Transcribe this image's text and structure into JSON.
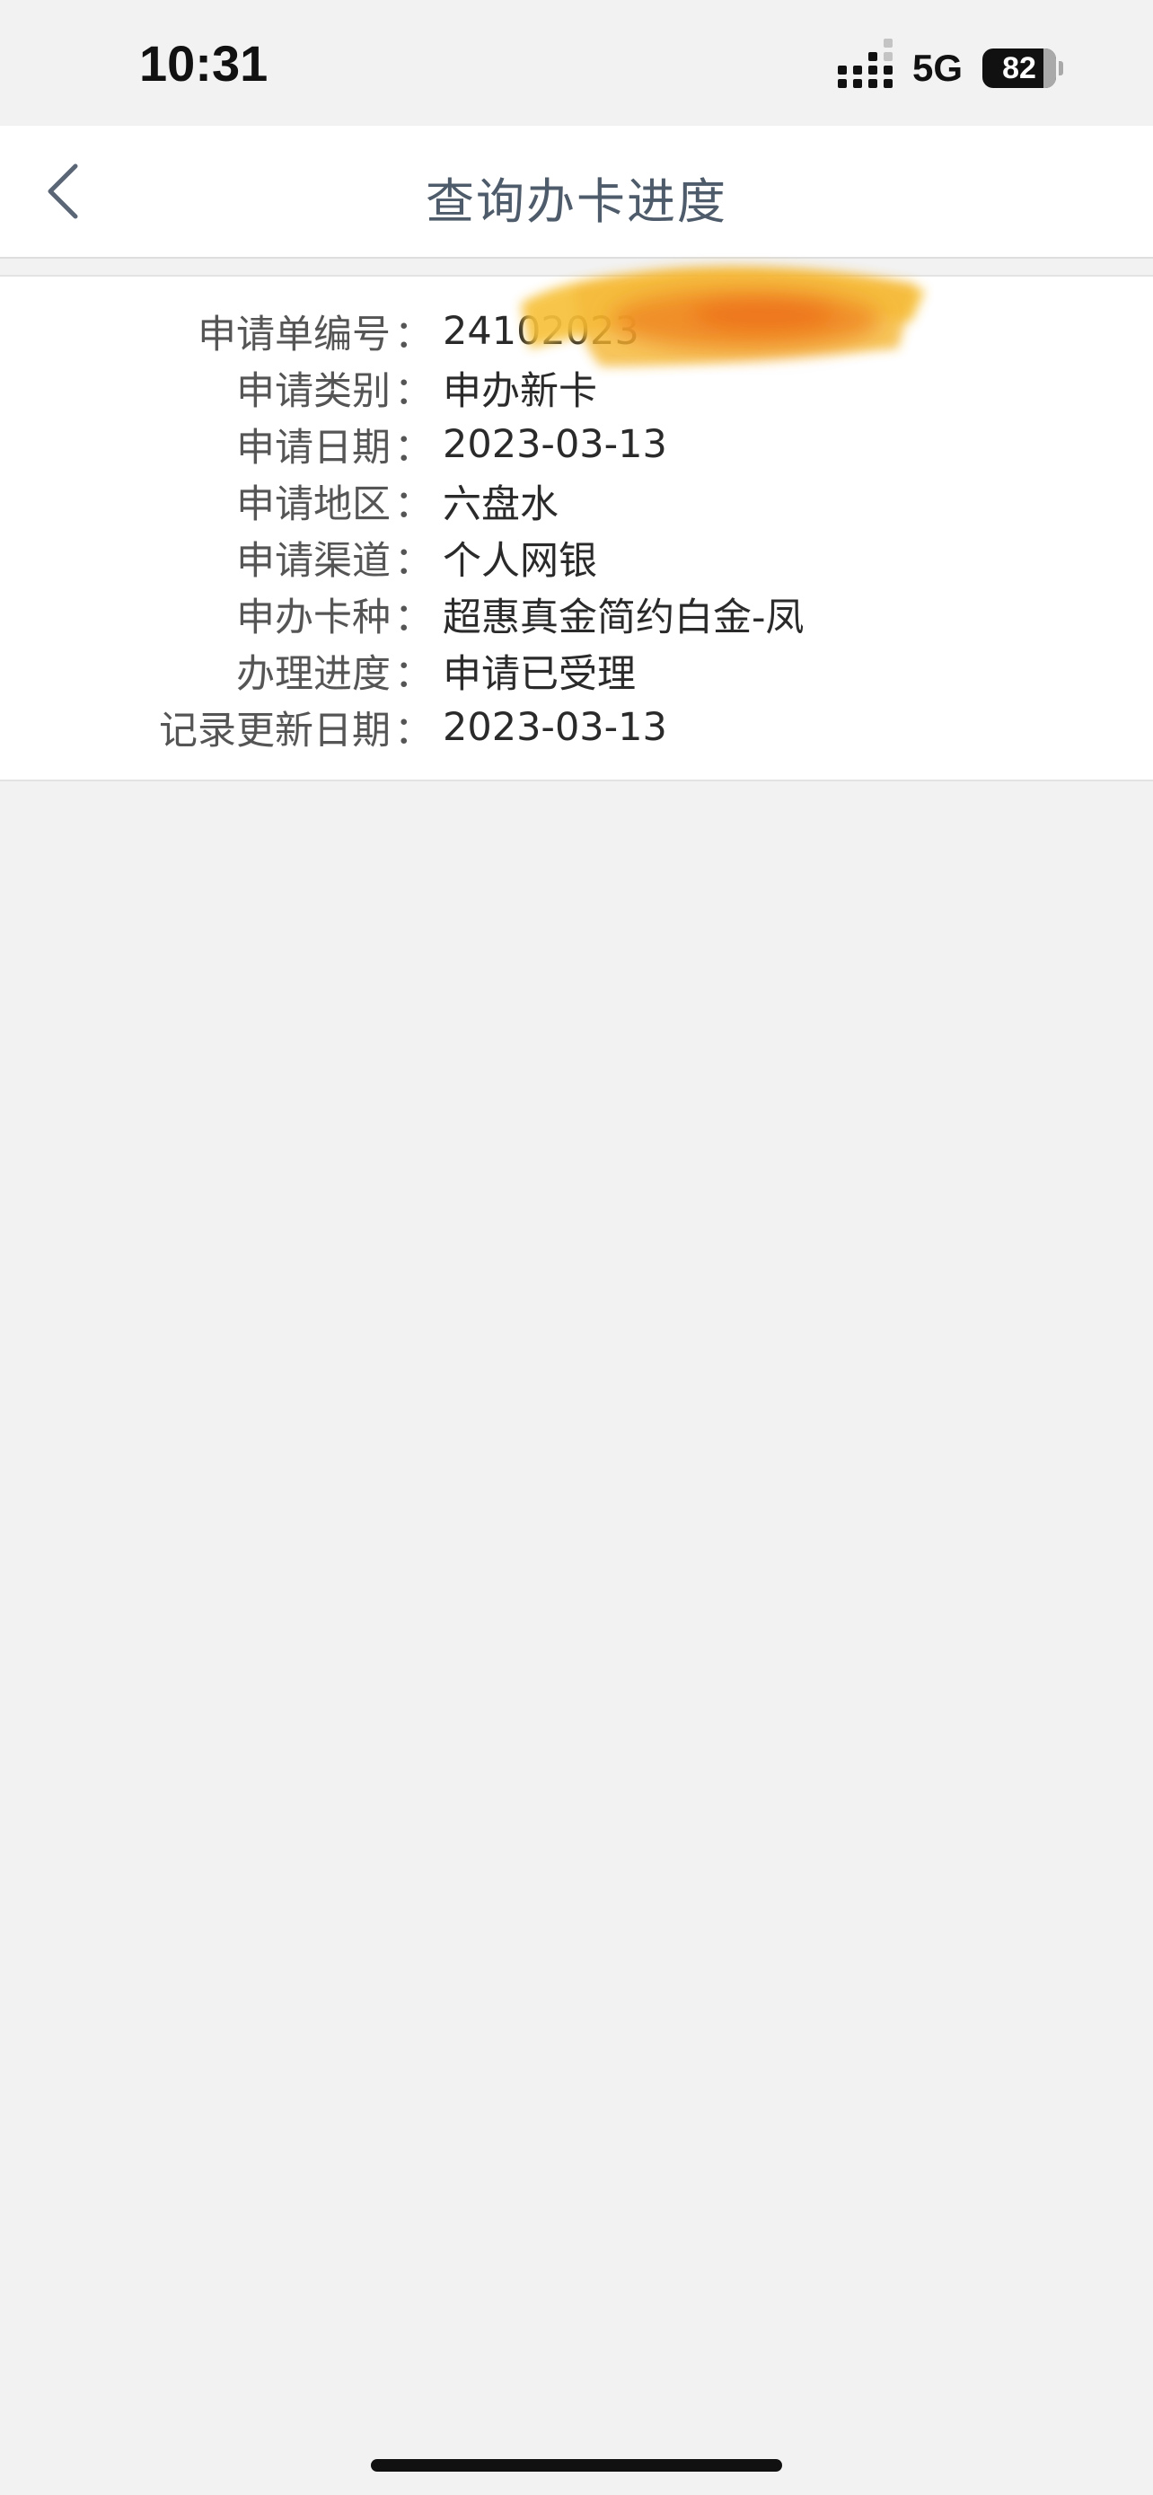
{
  "status_bar": {
    "time": "10:31",
    "network": "5G",
    "battery": "82",
    "icons": [
      "signal-icon",
      "battery-icon"
    ]
  },
  "nav": {
    "title": "查询办卡进度",
    "back_icon": "chevron-left-icon"
  },
  "details": {
    "colon": "：",
    "rows": [
      {
        "label": "申请单编号",
        "value": "24102023"
      },
      {
        "label": "申请类别",
        "value": "申办新卡"
      },
      {
        "label": "申请日期",
        "value": "2023-03-13"
      },
      {
        "label": "申请地区",
        "value": "六盘水"
      },
      {
        "label": "申请渠道",
        "value": "个人网银"
      },
      {
        "label": "申办卡种",
        "value": "超惠真金简约白金-凤"
      },
      {
        "label": "办理进度",
        "value": "申请已受理"
      },
      {
        "label": "记录更新日期",
        "value": "2023-03-13"
      }
    ]
  },
  "colors": {
    "background": "#f2f2f2",
    "card": "#ffffff",
    "title": "#4e5b6a",
    "redaction": "#f5a623"
  }
}
